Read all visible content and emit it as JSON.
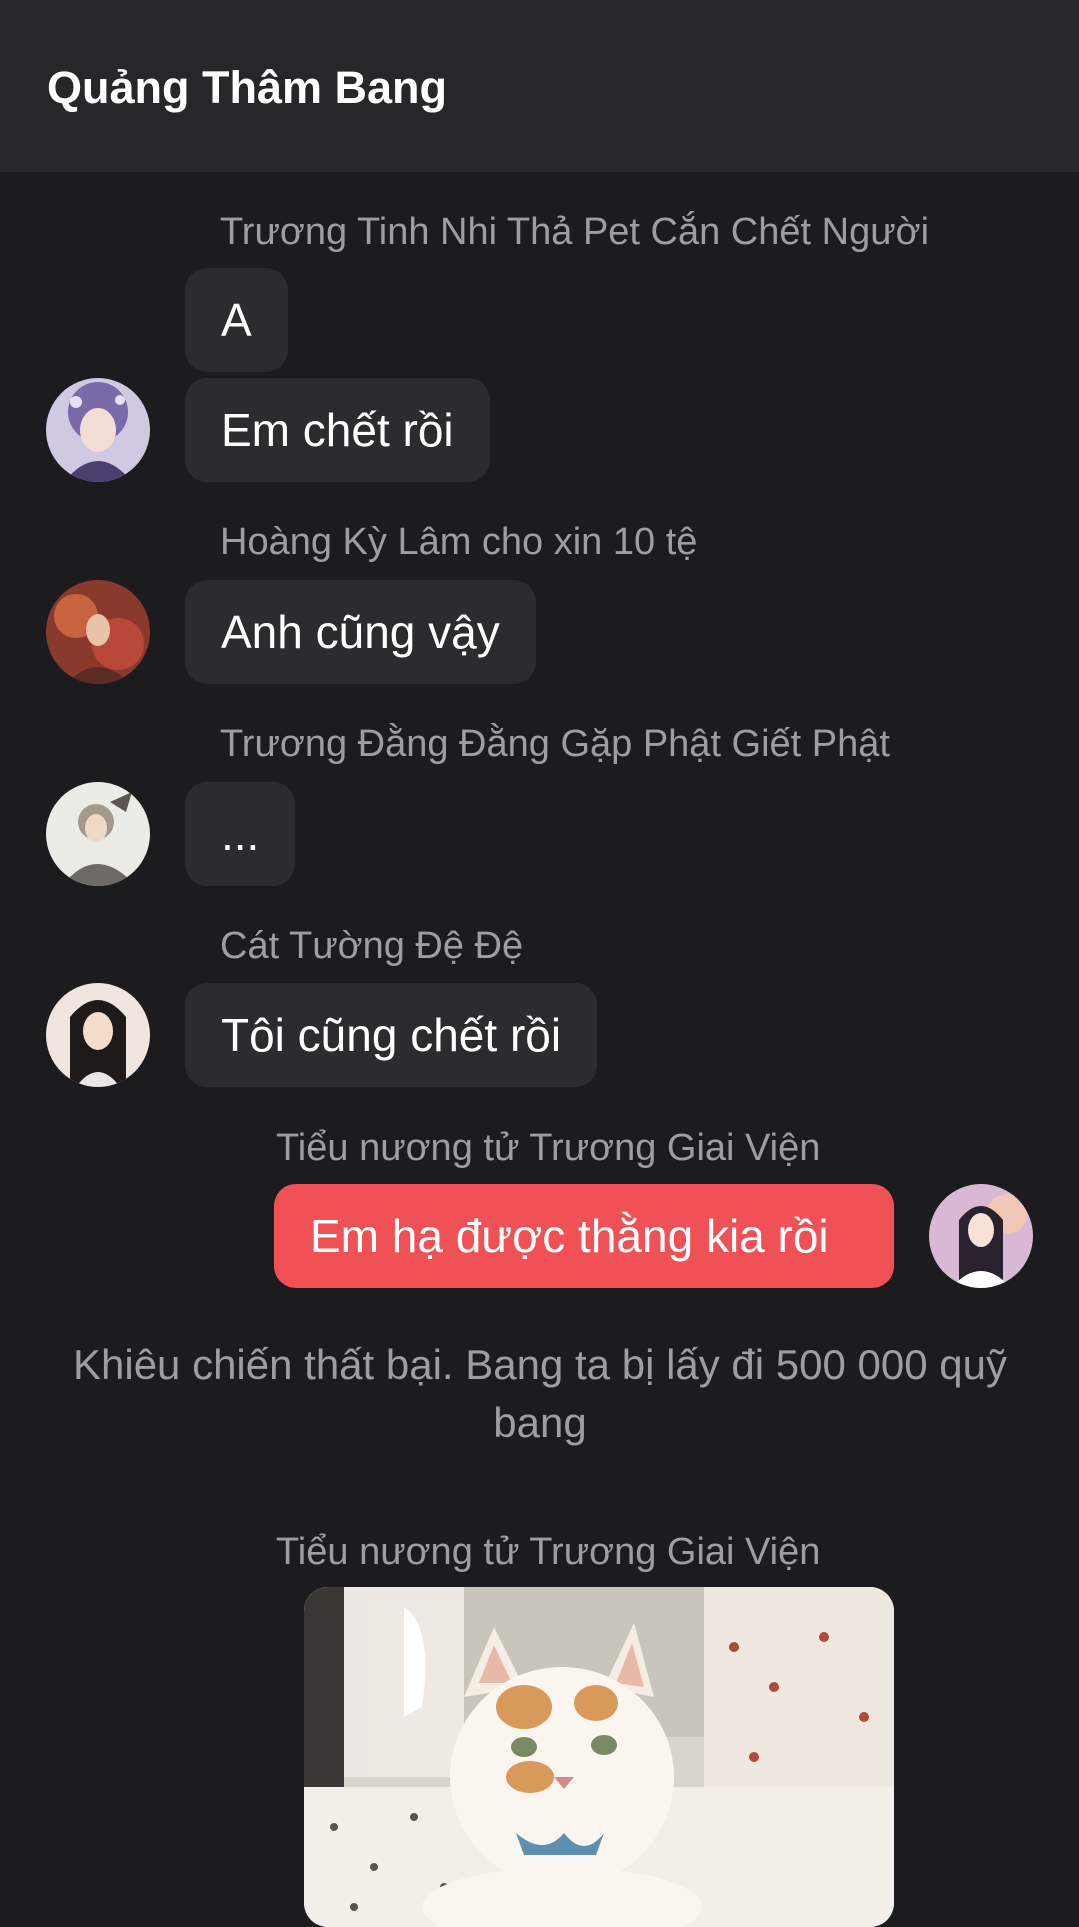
{
  "header": {
    "title": "Quảng Thâm Bang"
  },
  "messages": [
    {
      "sender": "Trương Tinh Nhi Thả Pet Cắn Chết Người",
      "bubbles": [
        "A",
        "Em chết rồi"
      ]
    },
    {
      "sender": "Hoàng Kỳ Lâm cho xin 10 tệ",
      "bubbles": [
        "Anh cũng vậy"
      ]
    },
    {
      "sender": "Trương Đằng Đằng Gặp Phật Giết Phật",
      "bubbles": [
        "..."
      ]
    },
    {
      "sender": "Cát Tường Đệ Đệ",
      "bubbles": [
        "Tôi cũng chết rồi"
      ]
    },
    {
      "sender": "Tiểu nương tử Trương Giai Viện",
      "bubbles": [
        "Em hạ được thằng kia rồi"
      ]
    }
  ],
  "system_message": "Khiêu chiến thất bại. Bang ta bị lấy đi 500 000 quỹ bang",
  "image_message": {
    "sender": "Tiểu nương tử Trương Giai Viện"
  },
  "colors": {
    "background": "#1c1c1e",
    "header": "#27272a",
    "bubble_received": "#2c2c2f",
    "bubble_sent": "#ef5157",
    "secondary_text": "#9d9da2"
  }
}
